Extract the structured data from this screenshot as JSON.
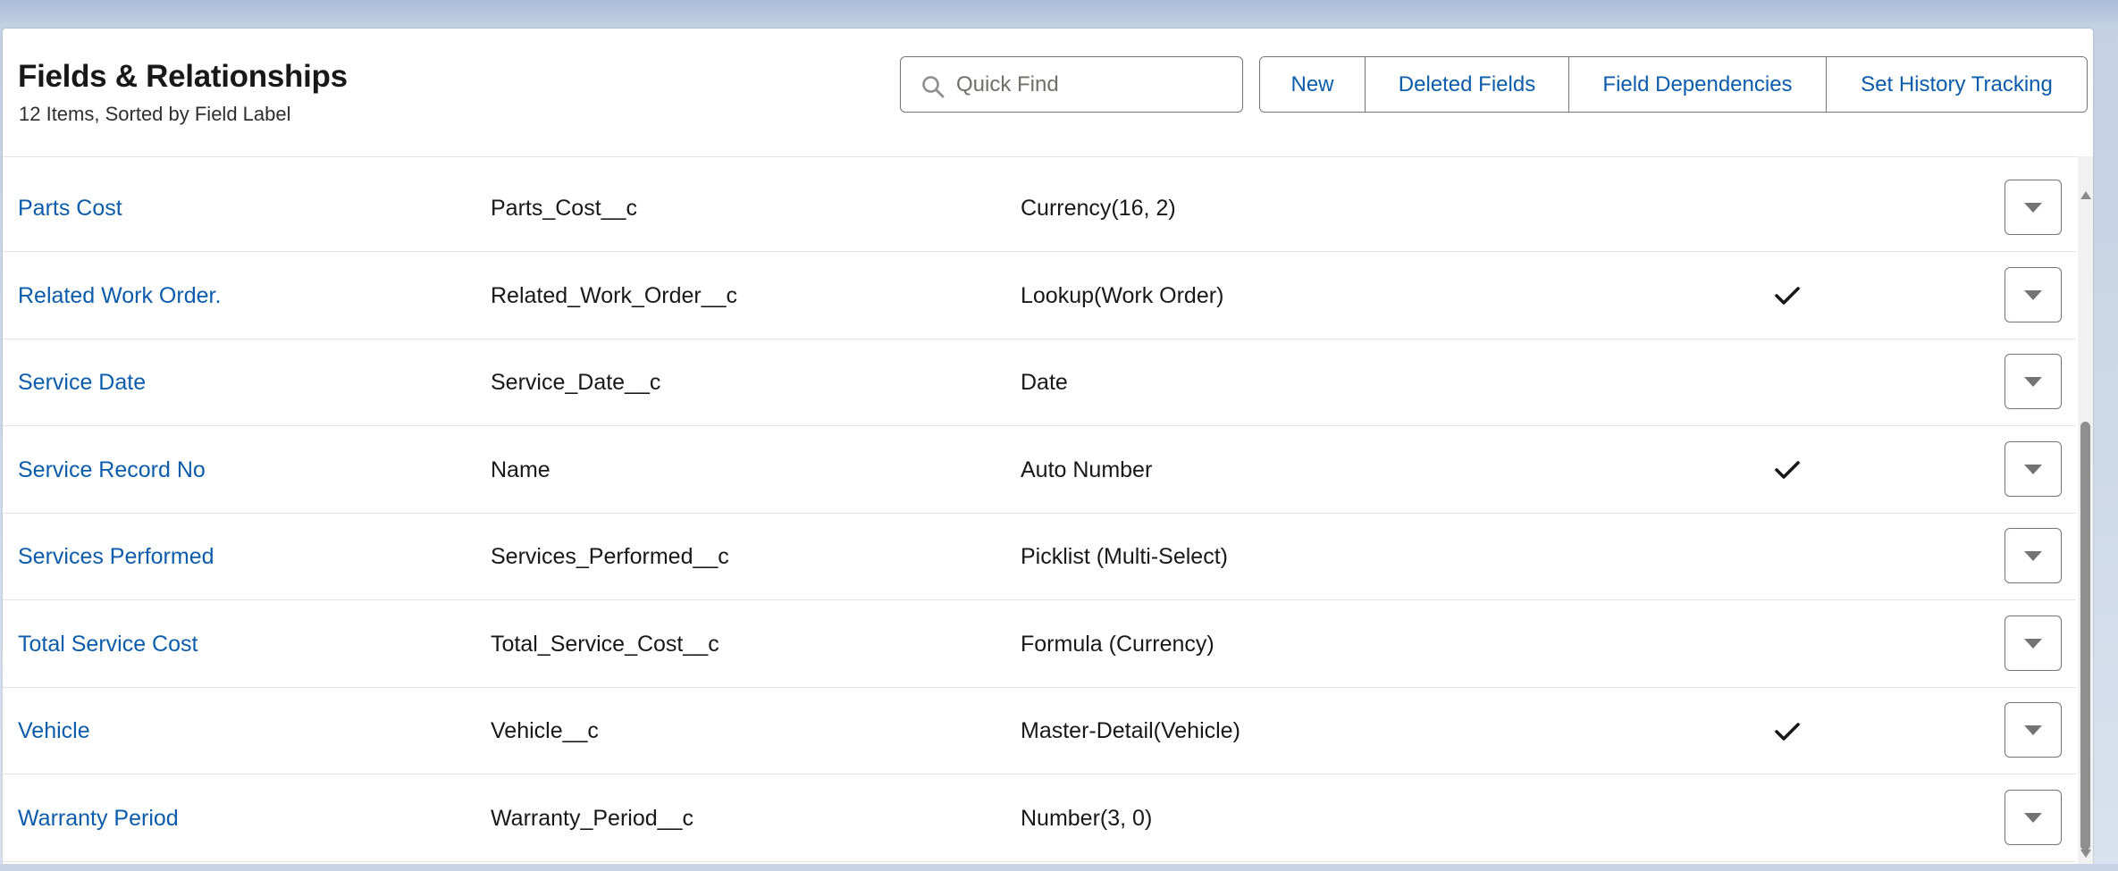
{
  "header": {
    "title": "Fields & Relationships",
    "subtitle": "12 Items, Sorted by Field Label",
    "search_placeholder": "Quick Find",
    "buttons": {
      "new": "New",
      "deleted_fields": "Deleted Fields",
      "field_dependencies": "Field Dependencies",
      "set_history_tracking": "Set History Tracking"
    }
  },
  "rows": [
    {
      "label": "Parts Cost",
      "api_name": "Parts_Cost__c",
      "type": "Currency(16, 2)",
      "indexed": false
    },
    {
      "label": "Related Work Order.",
      "api_name": "Related_Work_Order__c",
      "type": "Lookup(Work Order)",
      "indexed": true
    },
    {
      "label": "Service Date",
      "api_name": "Service_Date__c",
      "type": "Date",
      "indexed": false
    },
    {
      "label": "Service Record No",
      "api_name": "Name",
      "type": "Auto Number",
      "indexed": true
    },
    {
      "label": "Services Performed",
      "api_name": "Services_Performed__c",
      "type": "Picklist (Multi-Select)",
      "indexed": false
    },
    {
      "label": "Total Service Cost",
      "api_name": "Total_Service_Cost__c",
      "type": "Formula (Currency)",
      "indexed": false
    },
    {
      "label": "Vehicle",
      "api_name": "Vehicle__c",
      "type": "Master-Detail(Vehicle)",
      "indexed": true
    },
    {
      "label": "Warranty Period",
      "api_name": "Warranty_Period__c",
      "type": "Number(3, 0)",
      "indexed": false
    }
  ],
  "colors": {
    "link": "#0b5cab",
    "text": "#181818",
    "border": "#747474"
  },
  "icons": {
    "search": "search-icon",
    "row_menu": "chevron-down-icon",
    "check": "checkmark-icon"
  }
}
